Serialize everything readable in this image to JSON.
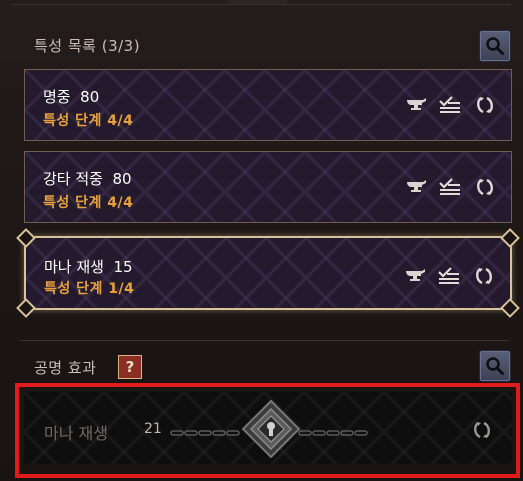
{
  "traits": {
    "title": "특성 목록 (3/3)",
    "items": [
      {
        "name": "명중",
        "value": "80",
        "level": "특성 단계 4/4"
      },
      {
        "name": "강타 적중",
        "value": "80",
        "level": "특성 단계 4/4"
      },
      {
        "name": "마나 재생",
        "value": "15",
        "level": "특성 단계 1/4"
      }
    ]
  },
  "resonance": {
    "title": "공명 효과",
    "help_label": "?",
    "name": "마나 재생",
    "value": "21"
  },
  "colors": {
    "level_text": "#e8a23c",
    "selected_border": "#d8c39b",
    "highlight": "#e11b1b"
  }
}
